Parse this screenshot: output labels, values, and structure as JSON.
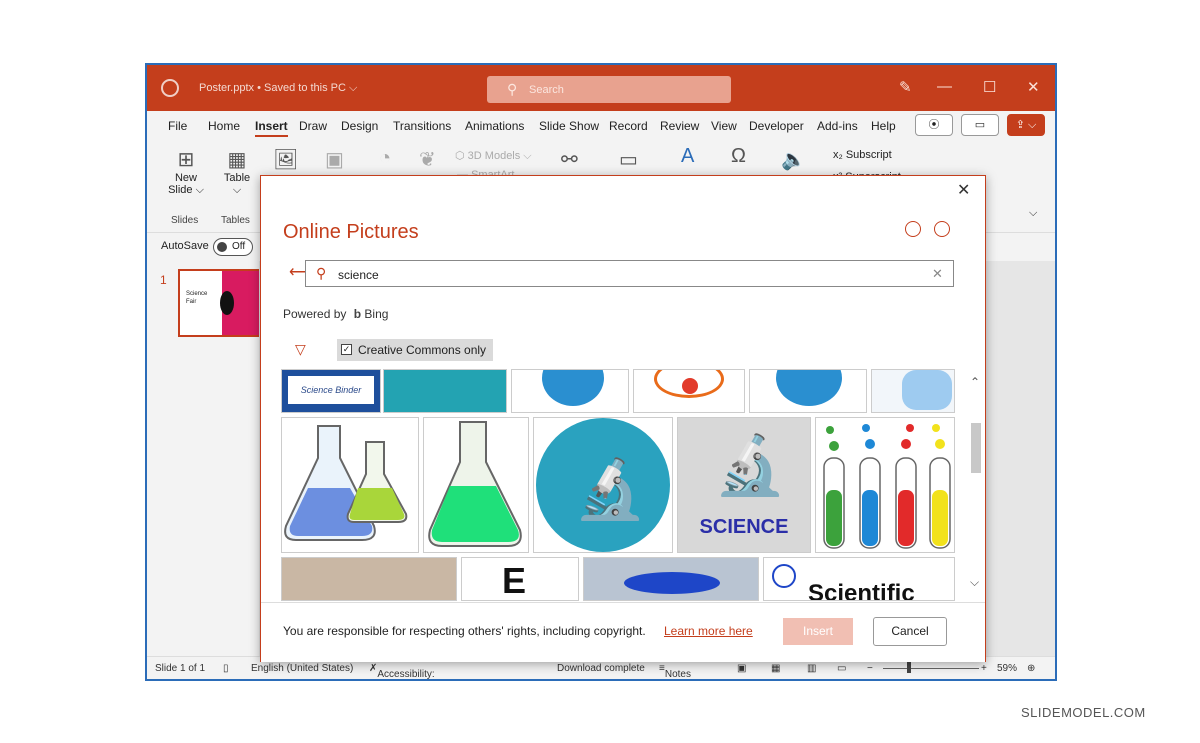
{
  "titlebar": {
    "filename": "Poster.pptx",
    "status": "Saved to this PC",
    "search_placeholder": "Search"
  },
  "menu": [
    "File",
    "Home",
    "Insert",
    "Draw",
    "Design",
    "Transitions",
    "Animations",
    "Slide Show",
    "Record",
    "Review",
    "View",
    "Developer",
    "Add-ins",
    "Help"
  ],
  "active_tab": "Insert",
  "ribbon": {
    "new_slide": "New",
    "new_slide2": "Slide",
    "table": "Table",
    "group_slides": "Slides",
    "group_tables": "Tables",
    "models": "3D Models",
    "smartart": "SmartArt",
    "subscript": "Subscript",
    "superscript": "Superscript"
  },
  "autosave": {
    "label": "AutoSave",
    "state": "Off"
  },
  "slide_panel": {
    "number": "1",
    "thumb_title": "Science",
    "thumb_sub": "Fair"
  },
  "statusbar": {
    "slide": "Slide 1 of 1",
    "language": "English (United States)",
    "accessibility": "Accessibility: Investigate",
    "download": "Download complete",
    "notes": "Notes",
    "zoom": "59%"
  },
  "dialog": {
    "title": "Online Pictures",
    "search_value": "science",
    "powered_by": "Powered by",
    "bing": "Bing",
    "cc_label": "Creative Commons only",
    "notice": "You are responsible for respecting others' rights, including copyright.",
    "learn_more": "Learn more here",
    "insert": "Insert",
    "cancel": "Cancel",
    "tile_science": "SCIENCE",
    "tile_binder": "Science Binder",
    "tile_scientific": "Scientific"
  },
  "colors": {
    "accent": "#c43e1c",
    "window_border": "#2b6cb8"
  },
  "watermark": "SLIDEMODEL.COM"
}
